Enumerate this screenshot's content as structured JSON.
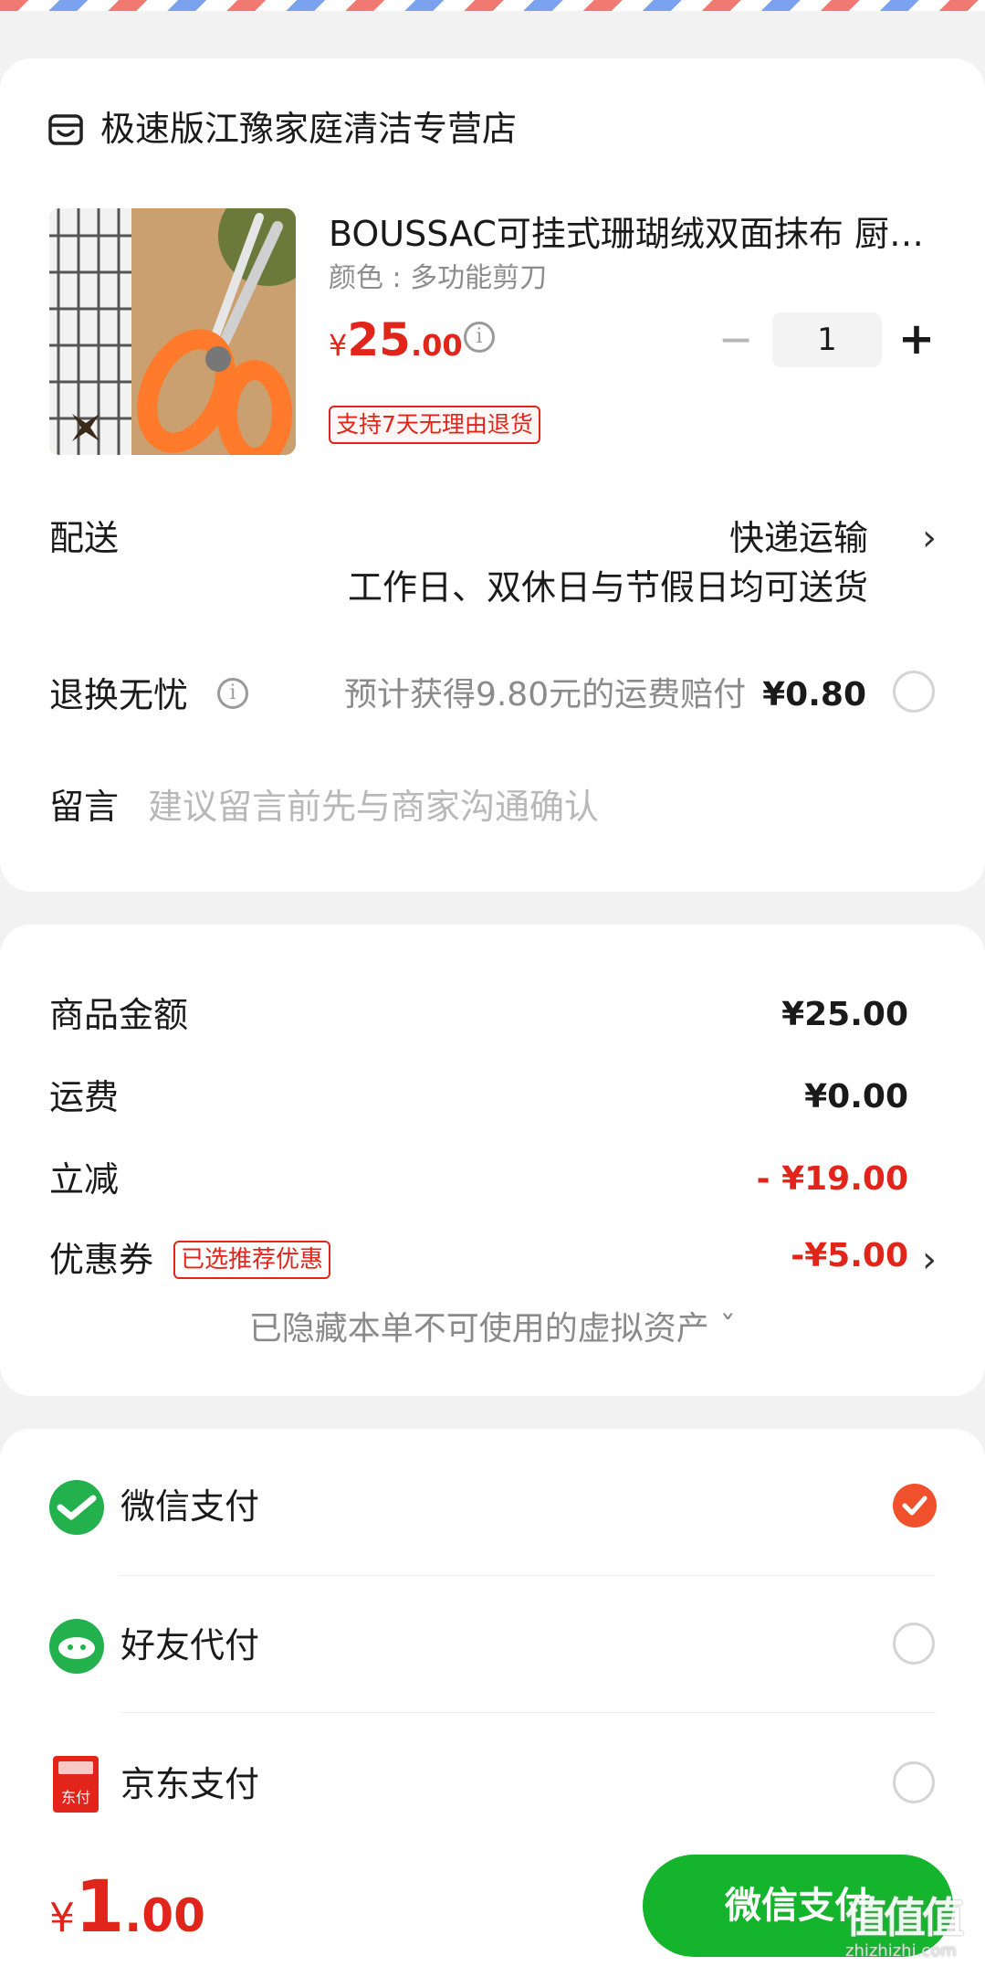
{
  "store": {
    "icon": "store-icon",
    "name": "极速版江豫家庭清洁专营店"
  },
  "product": {
    "title": "BOUSSAC可挂式珊瑚绒双面抹布 厨房用品抹布多功能",
    "spec": "颜色 : 多功能剪刀",
    "price_currency": "¥",
    "price_int": "25",
    "price_dec": ".00",
    "quantity": "1",
    "minus": "−",
    "plus": "+",
    "return_tag": "支持7天无理由退货"
  },
  "delivery": {
    "label": "配送",
    "method": "快递运输",
    "note": "工作日、双休日与节假日均可送货"
  },
  "return_insurance": {
    "label": "退换无忧",
    "desc": "预计获得9.80元的运费赔付",
    "price": "¥0.80"
  },
  "message": {
    "label": "留言",
    "placeholder": "建议留言前先与商家沟通确认",
    "value": ""
  },
  "summary": {
    "goods_label": "商品金额",
    "goods_value": "¥25.00",
    "shipping_label": "运费",
    "shipping_value": "¥0.00",
    "discount_label": "立减",
    "discount_value": "- ¥19.00",
    "coupon_label": "优惠券",
    "coupon_tag": "已选推荐优惠",
    "coupon_value": "-¥5.00",
    "hidden_assets": "已隐藏本单不可使用的虚拟资产 ˇ"
  },
  "payment": {
    "methods": [
      {
        "label": "微信支付",
        "icon": "wechat-pay-icon",
        "selected": true
      },
      {
        "label": "好友代付",
        "icon": "friend-pay-icon",
        "selected": false
      },
      {
        "label": "京东支付",
        "icon": "jd-pay-icon",
        "selected": false
      }
    ],
    "jd_icon_text": "东付"
  },
  "footer": {
    "total_currency": "¥",
    "total_int": "1",
    "total_dec": ".00",
    "pay_button": "微信支付"
  },
  "watermark": {
    "logo": "值值值",
    "url": "zhizhizhi.com"
  },
  "colors": {
    "accent_red": "#e1251b",
    "wechat_green": "#14b42c",
    "check_orange": "#f0512c"
  }
}
